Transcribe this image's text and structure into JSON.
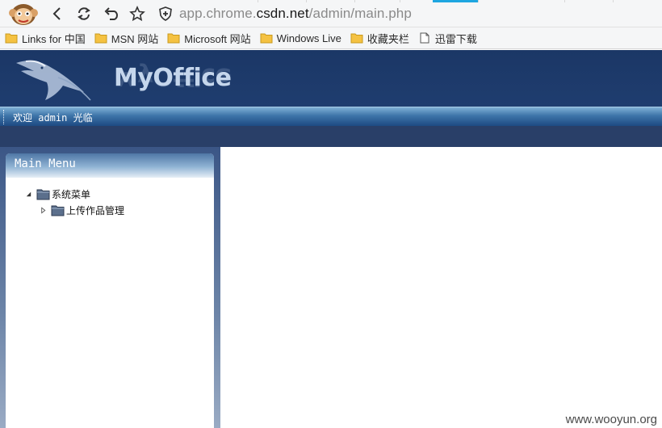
{
  "browser": {
    "url_prefix": "app.chrome.",
    "url_host": "csdn.net",
    "url_path": "/admin/main.php"
  },
  "bookmarks": [
    {
      "label": "Links for 中国",
      "icon": "folder-icon"
    },
    {
      "label": "MSN 网站",
      "icon": "folder-icon"
    },
    {
      "label": "Microsoft 网站",
      "icon": "folder-icon"
    },
    {
      "label": "Windows Live",
      "icon": "folder-icon"
    },
    {
      "label": "收藏夹栏",
      "icon": "folder-icon"
    },
    {
      "label": "迅雷下载",
      "icon": "page-icon"
    }
  ],
  "app": {
    "brand": "MyOffice",
    "welcome": "欢迎 admin 光临"
  },
  "menu": {
    "title": "Main Menu",
    "root": "系统菜单",
    "child": "上传作品管理"
  },
  "watermark": "www.wooyun.org",
  "colors": {
    "header": "#1f3d6f",
    "accent": "#1ea6e0",
    "brand_text": "#c5d6ec"
  }
}
